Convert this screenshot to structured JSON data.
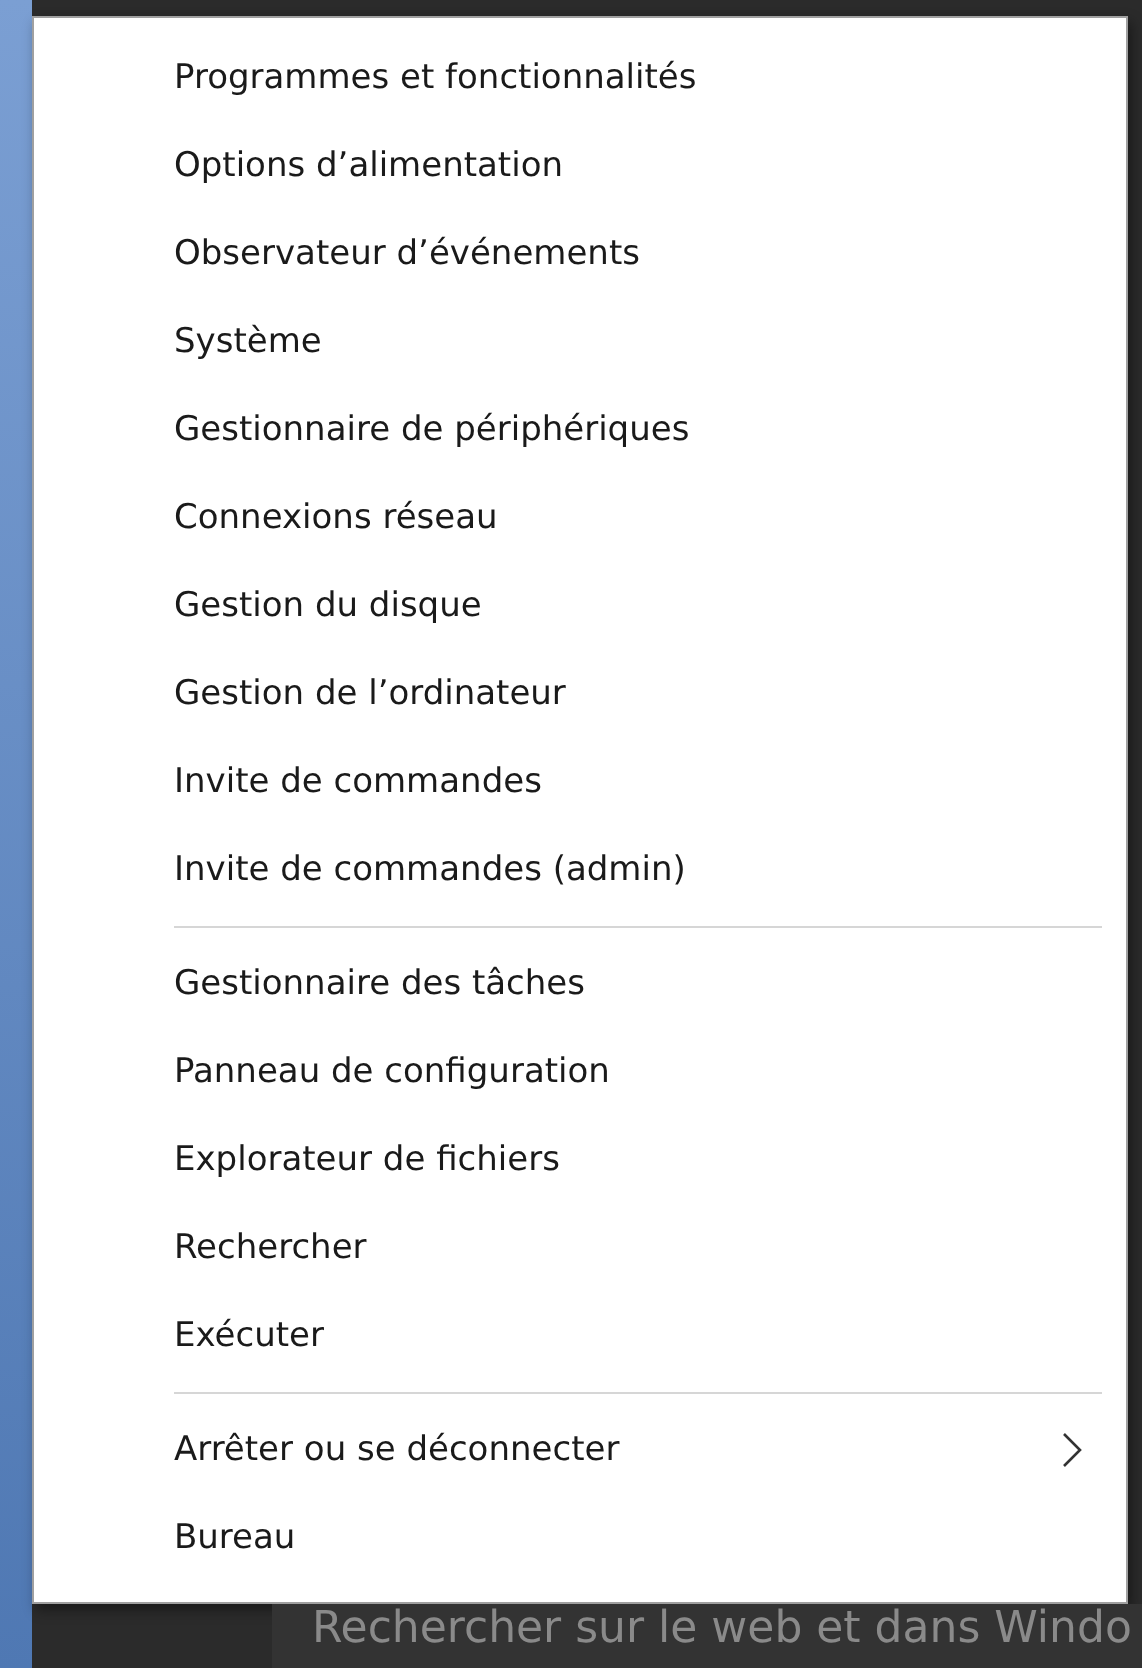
{
  "menu": {
    "groups": [
      {
        "items": [
          {
            "label": "Programmes et fonctionnalités",
            "submenu": false
          },
          {
            "label": "Options d’alimentation",
            "submenu": false
          },
          {
            "label": "Observateur d’événements",
            "submenu": false
          },
          {
            "label": "Système",
            "submenu": false
          },
          {
            "label": "Gestionnaire de périphériques",
            "submenu": false
          },
          {
            "label": "Connexions réseau",
            "submenu": false
          },
          {
            "label": "Gestion du disque",
            "submenu": false
          },
          {
            "label": "Gestion de l’ordinateur",
            "submenu": false
          },
          {
            "label": "Invite de commandes",
            "submenu": false
          },
          {
            "label": "Invite de commandes (admin)",
            "submenu": false
          }
        ]
      },
      {
        "items": [
          {
            "label": "Gestionnaire des tâches",
            "submenu": false
          },
          {
            "label": "Panneau de configuration",
            "submenu": false
          },
          {
            "label": "Explorateur de fichiers",
            "submenu": false
          },
          {
            "label": "Rechercher",
            "submenu": false
          },
          {
            "label": "Exécuter",
            "submenu": false
          }
        ]
      },
      {
        "items": [
          {
            "label": "Arrêter ou se déconnecter",
            "submenu": true
          },
          {
            "label": "Bureau",
            "submenu": false
          }
        ]
      }
    ]
  },
  "taskbar": {
    "search_text": "Rechercher sur le web et dans Windo"
  }
}
